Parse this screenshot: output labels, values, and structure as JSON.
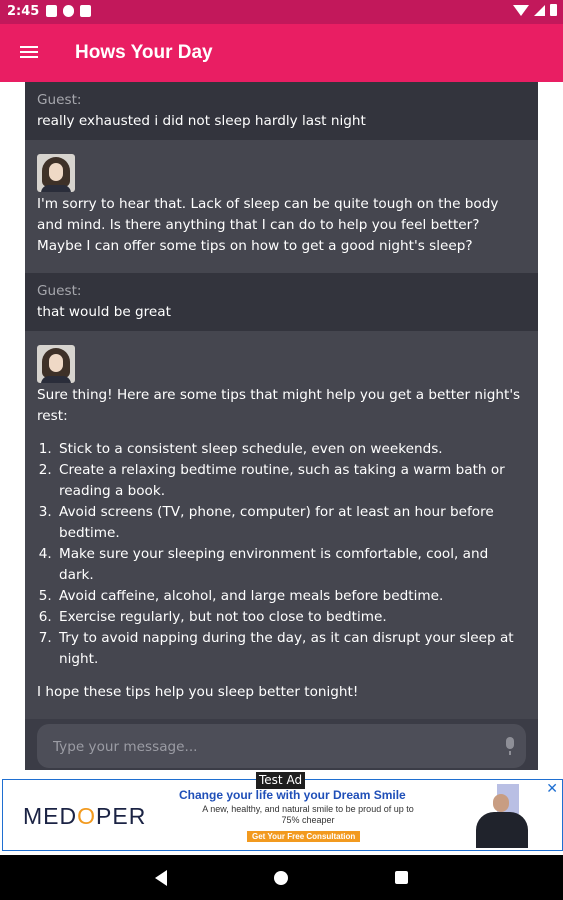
{
  "status_bar": {
    "time": "2:45"
  },
  "app_bar": {
    "title": "Hows Your Day"
  },
  "messages": [
    {
      "role": "user",
      "sender": "Guest:",
      "text": "really exhausted i did not sleep hardly last night"
    },
    {
      "role": "bot",
      "text": "I'm sorry to hear that. Lack of sleep can be quite tough on the body and mind. Is there anything that I can do to help you feel better? Maybe I can offer some tips on how to get a good night's sleep?"
    },
    {
      "role": "user",
      "sender": "Guest:",
      "text": "that would be great"
    },
    {
      "role": "bot",
      "intro": "Sure thing! Here are some tips that might help you get a better night's rest:",
      "tips": [
        "Stick to a consistent sleep schedule, even on weekends.",
        "Create a relaxing bedtime routine, such as taking a warm bath or reading a book.",
        "Avoid screens (TV, phone, computer) for at least an hour before bedtime.",
        "Make sure your sleeping environment is comfortable, cool, and dark.",
        "Avoid caffeine, alcohol, and large meals before bedtime.",
        "Exercise regularly, but not too close to bedtime.",
        "Try to avoid napping during the day, as it can disrupt your sleep at night."
      ],
      "outro": "I hope these tips help you sleep better tonight!"
    }
  ],
  "composer": {
    "placeholder": "Type your message..."
  },
  "ad": {
    "label": "Test Ad",
    "brand_prefix": "MED",
    "brand_o": "O",
    "brand_suffix": "PER",
    "headline": "Change your life with your Dream Smile",
    "subtext": "A new, healthy, and natural smile to be proud of up to 75% cheaper",
    "cta": "Get Your Free Consultation",
    "close": "✕"
  },
  "colors": {
    "app_bar": "#e91e63",
    "status_bar": "#c2185b",
    "chat_bg": "#3b3c46",
    "user_bubble": "#33343d",
    "bot_bubble": "#45464f"
  }
}
